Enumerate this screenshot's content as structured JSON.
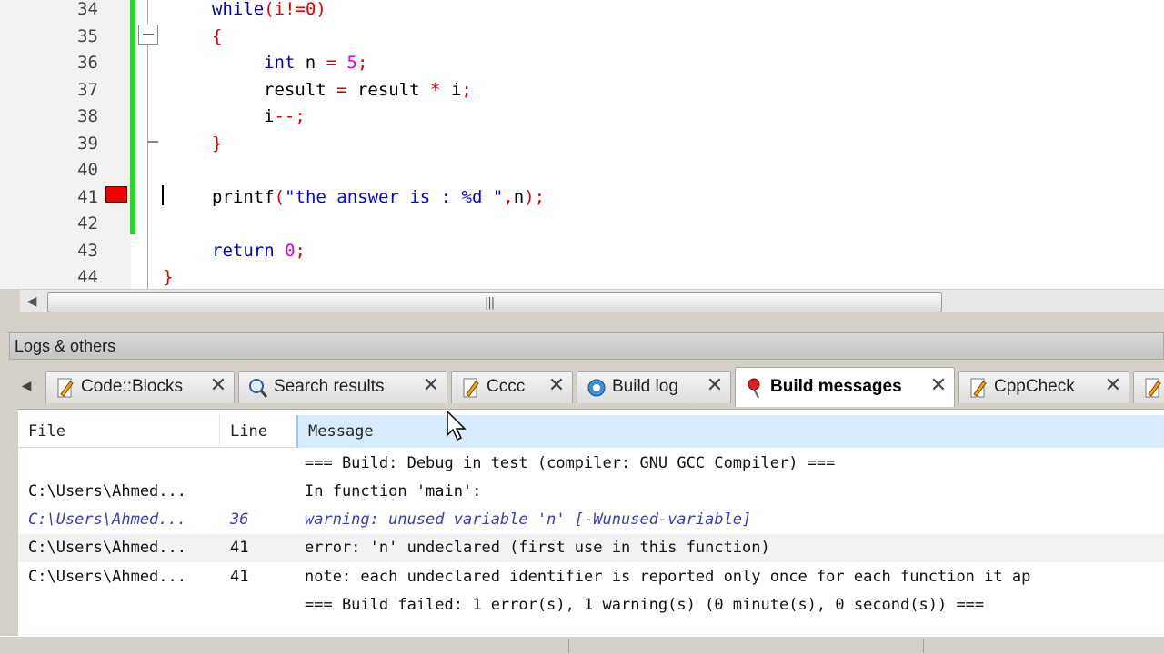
{
  "editor": {
    "lines": [
      {
        "num": "34"
      },
      {
        "num": "35"
      },
      {
        "num": "36"
      },
      {
        "num": "37"
      },
      {
        "num": "38"
      },
      {
        "num": "39"
      },
      {
        "num": "40"
      },
      {
        "num": "41"
      },
      {
        "num": "42"
      },
      {
        "num": "43"
      },
      {
        "num": "44"
      }
    ],
    "code": {
      "l34_kw": "while",
      "l34_rest": "(i!=0)",
      "l35": "{",
      "l36_kw": "int",
      "l36_var": " n ",
      "l36_eq": "=",
      "l36_num": " 5",
      "l36_semi": ";",
      "l37_a": "result ",
      "l37_eq": "=",
      "l37_b": " result ",
      "l37_star": "*",
      "l37_c": " i",
      "l37_semi": ";",
      "l38_a": "i",
      "l38_op": "--;",
      "l39": "}",
      "l41_fn": "printf",
      "l41_open": "(",
      "l41_str": "\"the answer is : %d \"",
      "l41_comma": ",",
      "l41_n": "n",
      "l41_close": ");",
      "l43_kw": "return",
      "l43_num": " 0",
      "l43_semi": ";",
      "l44": "}"
    },
    "breakpoint_line": "41"
  },
  "logs": {
    "title": "Logs & others",
    "tabs": [
      {
        "label": "Code::Blocks",
        "icon": "pencil-icon"
      },
      {
        "label": "Search results",
        "icon": "magnifier-icon"
      },
      {
        "label": "Cccc",
        "icon": "pencil-icon"
      },
      {
        "label": "Build log",
        "icon": "gear-icon"
      },
      {
        "label": "Build messages",
        "icon": "pin-icon",
        "active": true
      },
      {
        "label": "CppCheck",
        "icon": "pencil-icon"
      }
    ],
    "close_glyph": "✕",
    "columns": {
      "file": "File",
      "line": "Line",
      "message": "Message"
    },
    "rows": [
      {
        "file": "",
        "line": "",
        "message": "=== Build: Debug in test (compiler: GNU GCC Compiler) ==="
      },
      {
        "file": "C:\\Users\\Ahmed...",
        "line": "",
        "message": "In function 'main':"
      },
      {
        "file": "C:\\Users\\Ahmed...",
        "line": "36",
        "message": "warning: unused variable 'n' [-Wunused-variable]"
      },
      {
        "file": "C:\\Users\\Ahmed...",
        "line": "41",
        "message": "error: 'n' undeclared (first use in this function)"
      },
      {
        "file": "C:\\Users\\Ahmed...",
        "line": "41",
        "message": "note: each undeclared identifier is reported only once for each function it ap"
      },
      {
        "file": "",
        "line": "",
        "message": "=== Build failed: 1 error(s), 1 warning(s) (0 minute(s), 0 second(s)) ==="
      }
    ]
  },
  "colors": {
    "keyword": "#0000c0",
    "number": "#e000e0",
    "operator": "#e00000",
    "string": "#0000ff",
    "change_bar": "#22dd22",
    "breakpoint": "#ee0000",
    "warning_text": "#3a3ac8"
  }
}
